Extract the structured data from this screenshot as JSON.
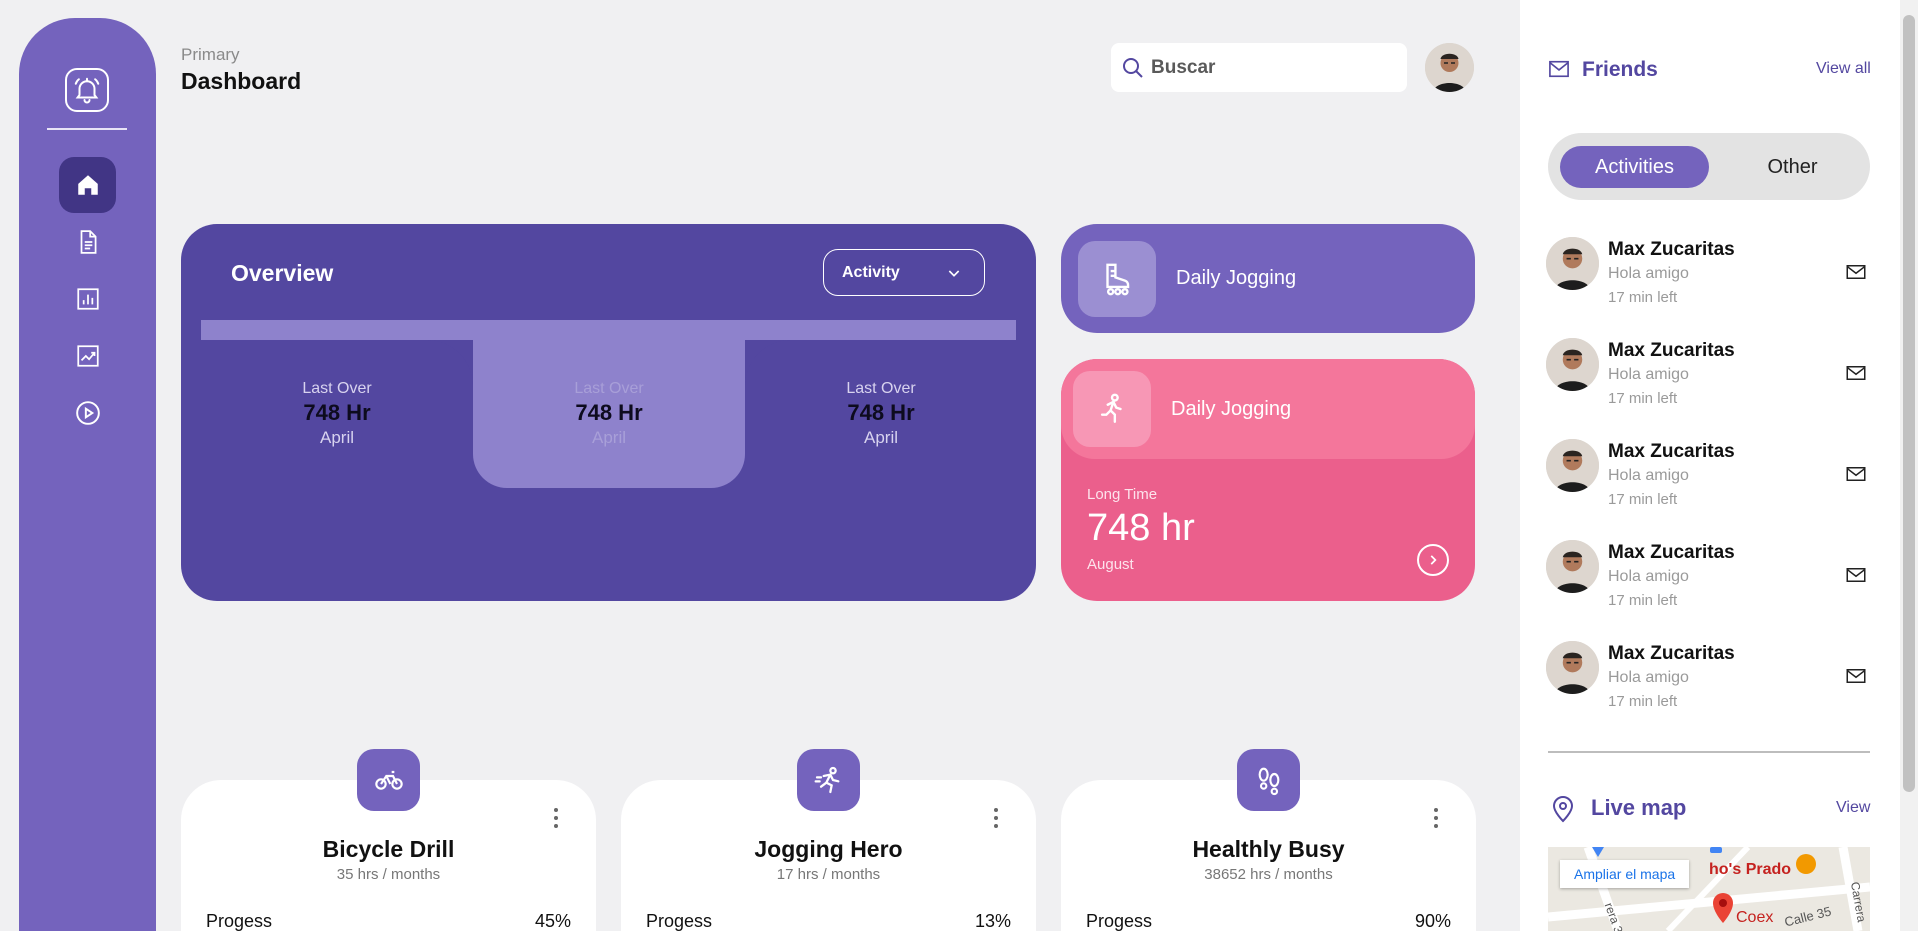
{
  "colors": {
    "primary": "#7463bd",
    "dark": "#5347a0",
    "pink": "#eb5f8c",
    "background": "#f0f0f2"
  },
  "sidebar": {
    "logo_icon": "alarm-bell-icon",
    "items": [
      {
        "name": "home",
        "icon": "home-icon"
      },
      {
        "name": "documents",
        "icon": "document-icon"
      },
      {
        "name": "reports",
        "icon": "bar-chart-icon"
      },
      {
        "name": "trends",
        "icon": "trend-chart-icon"
      },
      {
        "name": "media",
        "icon": "play-icon"
      }
    ]
  },
  "header": {
    "subtitle": "Primary",
    "title": "Dashboard",
    "search_placeholder": "Buscar"
  },
  "overview": {
    "title": "Overview",
    "dropdown_value": "Activity",
    "tabs": [
      {
        "label": "Last Over",
        "value": "748 Hr",
        "month": "April"
      },
      {
        "label": "Last Over",
        "value": "748 Hr",
        "month": "April"
      },
      {
        "label": "Last Over",
        "value": "748 Hr",
        "month": "April"
      }
    ]
  },
  "jogging_card_1": {
    "title": "Daily Jogging",
    "icon": "roller-skate-icon"
  },
  "jogging_card_2": {
    "title": "Daily Jogging",
    "icon": "runner-icon",
    "stat_label": "Long Time",
    "stat_value": "748 hr",
    "stat_month": "August"
  },
  "activities": [
    {
      "title": "Bicycle Drill",
      "subtitle": "35 hrs / months",
      "progress_label": "Progess",
      "progress": "45%",
      "icon": "bicycle-icon"
    },
    {
      "title": "Jogging Hero",
      "subtitle": "17 hrs / months",
      "progress_label": "Progess",
      "progress": "13%",
      "icon": "running-icon"
    },
    {
      "title": "Healthly Busy",
      "subtitle": "38652 hrs / months",
      "progress_label": "Progess",
      "progress": "90%",
      "icon": "footprints-icon"
    }
  ],
  "friends": {
    "title": "Friends",
    "view_all": "View all",
    "tabs": [
      "Activities",
      "Other"
    ],
    "list": [
      {
        "name": "Max Zucaritas",
        "message": "Hola amigo",
        "time": "17 min left"
      },
      {
        "name": "Max Zucaritas",
        "message": "Hola amigo",
        "time": "17 min left"
      },
      {
        "name": "Max Zucaritas",
        "message": "Hola amigo",
        "time": "17 min left"
      },
      {
        "name": "Max Zucaritas",
        "message": "Hola amigo",
        "time": "17 min left"
      },
      {
        "name": "Max Zucaritas",
        "message": "Hola amigo",
        "time": "17 min left"
      }
    ]
  },
  "live_map": {
    "title": "Live map",
    "view": "View",
    "enlarge_button": "Ampliar el mapa",
    "labels": [
      "ho's Prado",
      "Coex",
      "Calle 35",
      "rera 3",
      "Carrera"
    ]
  }
}
